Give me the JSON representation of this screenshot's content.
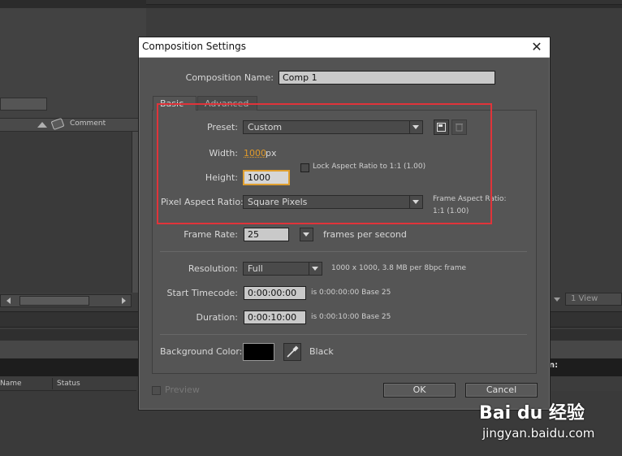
{
  "background_app": {
    "comment_header": "Comment",
    "columns": {
      "name": "Name",
      "status": "Status"
    },
    "view_select": "1 View",
    "dark_strip_text": "n:"
  },
  "watermark": {
    "brand": "Bai du 经验",
    "url": "jingyan.baidu.com"
  },
  "dialog": {
    "title": "Composition Settings",
    "close_symbol": "✕",
    "composition_name_label": "Composition Name:",
    "composition_name_value": "Comp 1",
    "tabs": [
      {
        "label": "Basic",
        "active": true
      },
      {
        "label": "Advanced",
        "active": false
      }
    ],
    "preset": {
      "label": "Preset:",
      "value": "Custom"
    },
    "width": {
      "label": "Width:",
      "value": "1000",
      "unit": "px"
    },
    "height": {
      "label": "Height:",
      "value": "1000"
    },
    "lock_aspect": {
      "label": "Lock Aspect Ratio to 1:1 (1.00)",
      "checked": false
    },
    "pixel_aspect": {
      "label": "Pixel Aspect Ratio:",
      "value": "Square Pixels",
      "frame_aspect_label": "Frame Aspect Ratio:",
      "frame_aspect_value": "1:1 (1.00)"
    },
    "frame_rate": {
      "label": "Frame Rate:",
      "value": "25",
      "unit": "frames per second"
    },
    "resolution": {
      "label": "Resolution:",
      "value": "Full",
      "info": "1000 x 1000, 3.8 MB per 8bpc frame"
    },
    "start_timecode": {
      "label": "Start Timecode:",
      "value": "0:00:00:00",
      "info": "is 0:00:00:00  Base 25"
    },
    "duration": {
      "label": "Duration:",
      "value": "0:00:10:00",
      "info": "is 0:00:10:00  Base 25"
    },
    "background_color": {
      "label": "Background Color:",
      "color": "#000000",
      "name": "Black"
    },
    "preview": {
      "label": "Preview",
      "checked": false
    },
    "ok_label": "OK",
    "cancel_label": "Cancel"
  },
  "colors": {
    "highlight_border": "#e0343a",
    "width_value": "#e09a2a",
    "dialog_bg": "#535353"
  }
}
